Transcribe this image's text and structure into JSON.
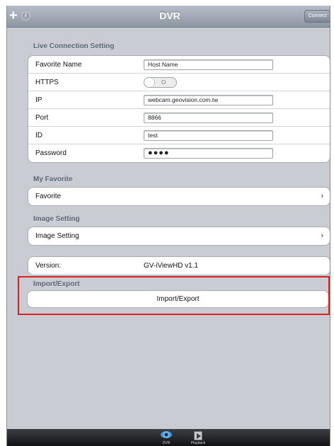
{
  "nav": {
    "plus_glyph": "+",
    "info_glyph": "i",
    "title": "DVR",
    "connect_label": "Connect"
  },
  "live_connection": {
    "section_title": "Live Connection Setting",
    "favorite_name": {
      "label": "Favorite Name",
      "value": "Host Name"
    },
    "https": {
      "label": "HTTPS",
      "toggle_text": "O",
      "state": "off"
    },
    "ip": {
      "label": "IP",
      "value": "webcam.geovision.com.tw"
    },
    "port": {
      "label": "Port",
      "value": "8866"
    },
    "id": {
      "label": "ID",
      "value": "test"
    },
    "password": {
      "label": "Password",
      "value": "●●●●"
    }
  },
  "my_favorite": {
    "section_title": "My Favorite",
    "favorite_label": "Favorite"
  },
  "image_setting": {
    "section_title": "Image Setting",
    "row_label": "Image Setting"
  },
  "version": {
    "label": "Version:",
    "value": "GV-iViewHD v1.1"
  },
  "import_export": {
    "section_title": "Import/Export",
    "button_label": "Import/Export",
    "highlight_color": "#e02020"
  },
  "chevron_glyph": "›",
  "tabbar": {
    "tabs": [
      {
        "icon": "eye-icon",
        "label": "DVR",
        "selected": true
      },
      {
        "icon": "playback-icon",
        "label": "Playback",
        "selected": false
      }
    ]
  }
}
